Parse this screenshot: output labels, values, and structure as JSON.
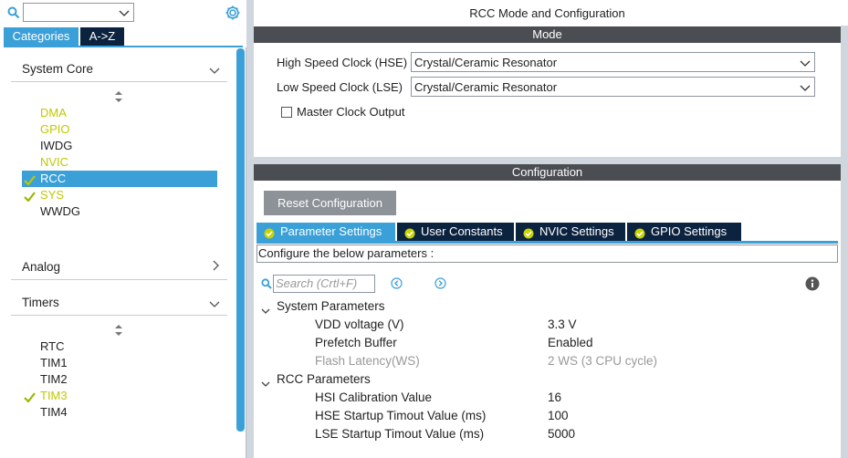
{
  "left": {
    "category_select_value": "",
    "tabs": [
      {
        "label": "Categories"
      },
      {
        "label": "A->Z"
      }
    ],
    "categories": [
      {
        "name": "System Core",
        "expanded": true,
        "items": [
          {
            "label": "DMA",
            "state": "yellow"
          },
          {
            "label": "GPIO",
            "state": "yellow"
          },
          {
            "label": "IWDG",
            "state": "normal"
          },
          {
            "label": "NVIC",
            "state": "yellow"
          },
          {
            "label": "RCC",
            "state": "selected"
          },
          {
            "label": "SYS",
            "state": "checked"
          },
          {
            "label": "WWDG",
            "state": "normal"
          }
        ]
      },
      {
        "name": "Analog",
        "expanded": false
      },
      {
        "name": "Timers",
        "expanded": true,
        "items": [
          {
            "label": "RTC",
            "state": "normal"
          },
          {
            "label": "TIM1",
            "state": "normal"
          },
          {
            "label": "TIM2",
            "state": "normal"
          },
          {
            "label": "TIM3",
            "state": "checked"
          },
          {
            "label": "TIM4",
            "state": "normal"
          }
        ]
      }
    ]
  },
  "mode_panel": {
    "title": "RCC Mode and Configuration",
    "section": "Mode",
    "hse_label": "High Speed Clock (HSE)",
    "hse_value": "Crystal/Ceramic Resonator",
    "lse_label": "Low Speed Clock (LSE)",
    "lse_value": "Crystal/Ceramic Resonator",
    "mco_label": "Master Clock Output",
    "mco_checked": false
  },
  "config_panel": {
    "section": "Configuration",
    "reset_label": "Reset Configuration",
    "tabs": [
      {
        "label": "Parameter Settings"
      },
      {
        "label": "User Constants"
      },
      {
        "label": "NVIC Settings"
      },
      {
        "label": "GPIO Settings"
      }
    ],
    "configure_text": "Configure the below parameters :",
    "search_placeholder": "Search (Crtl+F)",
    "groups": [
      {
        "name": "System Parameters",
        "params": [
          {
            "name": "VDD voltage (V)",
            "value": "3.3 V",
            "dim": false
          },
          {
            "name": "Prefetch Buffer",
            "value": "Enabled",
            "dim": false
          },
          {
            "name": "Flash Latency(WS)",
            "value": "2 WS (3 CPU cycle)",
            "dim": true
          }
        ]
      },
      {
        "name": "RCC Parameters",
        "params": [
          {
            "name": "HSI Calibration Value",
            "value": "16",
            "dim": false
          },
          {
            "name": "HSE Startup Timout Value (ms)",
            "value": "100",
            "dim": false
          },
          {
            "name": "LSE Startup Timout Value (ms)",
            "value": "5000",
            "dim": false
          }
        ]
      }
    ]
  },
  "colors": {
    "accent": "#3ba0d8",
    "dark_tab": "#0c2340",
    "bar": "#4a4d52",
    "yellow": "#c0c800"
  }
}
